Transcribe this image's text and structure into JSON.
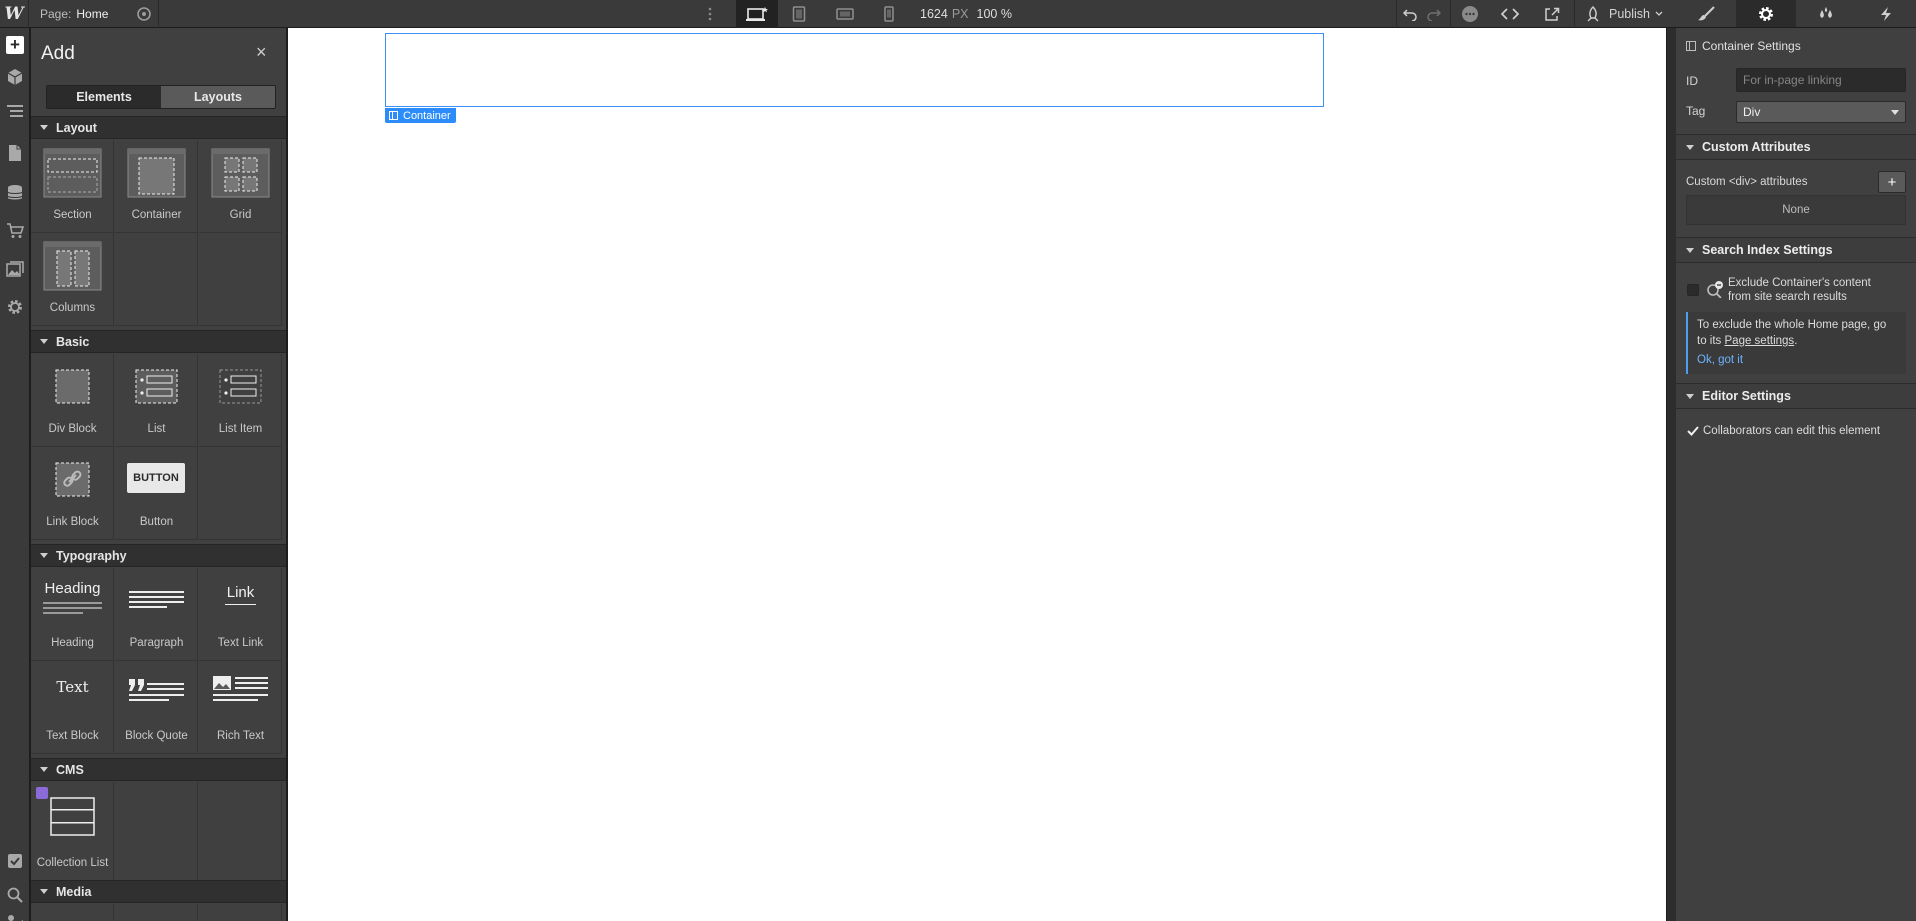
{
  "topbar": {
    "logo": "W",
    "page_prefix": "Page:",
    "page_name": "Home",
    "canvas_width": "1624",
    "width_unit": "PX",
    "zoom": "100",
    "zoom_unit": "%",
    "publish_label": "Publish"
  },
  "add_panel": {
    "title": "Add",
    "close": "×",
    "tabs": [
      "Elements",
      "Layouts"
    ],
    "sections": {
      "layout": "Layout",
      "basic": "Basic",
      "typography": "Typography",
      "cms": "CMS",
      "media": "Media"
    },
    "items": {
      "section": "Section",
      "container": "Container",
      "grid": "Grid",
      "columns": "Columns",
      "div_block": "Div Block",
      "list": "List",
      "list_item": "List Item",
      "link_block": "Link Block",
      "button": "Button",
      "heading": "Heading",
      "paragraph": "Paragraph",
      "text_link": "Text Link",
      "text_block": "Text Block",
      "block_quote": "Block Quote",
      "rich_text": "Rich Text",
      "collection_list": "Collection List"
    },
    "icon_text": {
      "button": "BUTTON",
      "heading": "Heading",
      "link": "Link",
      "text": "Text"
    }
  },
  "canvas": {
    "selected_tag": "Container"
  },
  "settings_panel": {
    "header": "Container Settings",
    "id_label": "ID",
    "id_placeholder": "For in-page linking",
    "tag_label": "Tag",
    "tag_value": "Div",
    "custom_attributes": {
      "title": "Custom Attributes",
      "row_label": "Custom <div> attributes",
      "add": "+",
      "empty": "None"
    },
    "search_index": {
      "title": "Search Index Settings",
      "exclude_line1": "Exclude Container's content",
      "exclude_line2": "from site search results",
      "note_text": "To exclude the whole Home page, go to its",
      "note_link": "Page settings",
      "note_end": ".",
      "ok": "Ok, got it"
    },
    "editor": {
      "title": "Editor Settings",
      "collab": "Collaborators can edit this element"
    }
  },
  "colors": {
    "selection": "#3b8ff5",
    "tag_bg": "#2c8dfa",
    "link": "#6db3ff",
    "cms_badge": "#8a6bd8"
  }
}
